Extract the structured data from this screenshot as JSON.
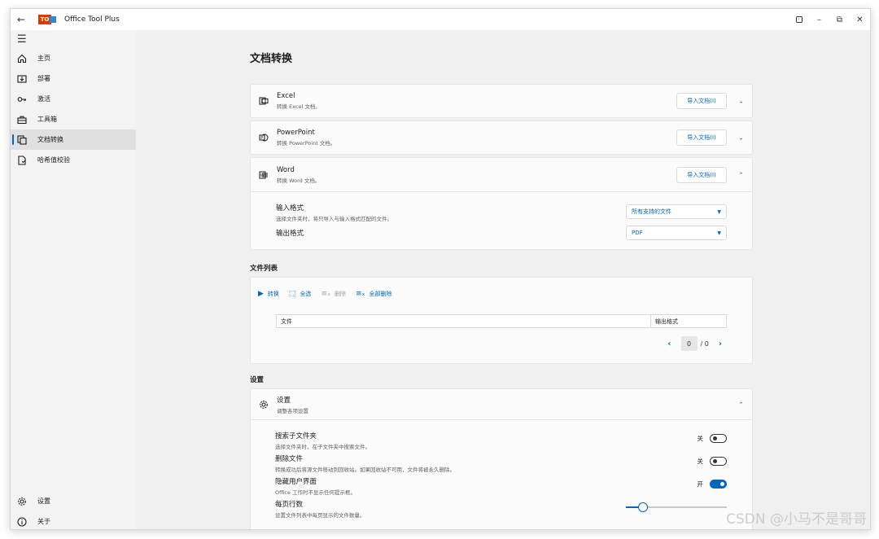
{
  "titlebar": {
    "app_title": "Office Tool Plus"
  },
  "sidebar": {
    "items": [
      {
        "label": "主页",
        "icon": "home-icon"
      },
      {
        "label": "部署",
        "icon": "deploy-icon"
      },
      {
        "label": "激活",
        "icon": "key-icon"
      },
      {
        "label": "工具箱",
        "icon": "toolbox-icon"
      },
      {
        "label": "文档转换",
        "icon": "convert-icon",
        "active": true
      },
      {
        "label": "哈希值校验",
        "icon": "hash-file-icon"
      }
    ],
    "bottom": [
      {
        "label": "设置",
        "icon": "gear-icon"
      },
      {
        "label": "关于",
        "icon": "info-icon"
      }
    ]
  },
  "page": {
    "title": "文档转换"
  },
  "converters": [
    {
      "title": "Excel",
      "sub": "转换 Excel 文档。",
      "button": "导入文档(I)",
      "chevron": "⌄"
    },
    {
      "title": "PowerPoint",
      "sub": "转换 PowerPoint 文档。",
      "button": "导入文档(I)",
      "chevron": "⌄"
    },
    {
      "title": "Word",
      "sub": "转换 Word 文档。",
      "button": "导入文档(I)",
      "chevron": "⌃"
    }
  ],
  "word_options": {
    "input_title": "输入格式",
    "input_sub": "选择文件夹时，将只导入与输入格式匹配的文件。",
    "input_value": "所有支持的文件",
    "output_title": "输出格式",
    "output_value": "PDF"
  },
  "file_list": {
    "label": "文件列表",
    "tools": {
      "convert": "转换",
      "select_all": "全选",
      "delete": "删除",
      "delete_all": "全部删除"
    },
    "columns": {
      "file": "文件",
      "output": "输出格式"
    },
    "pager": {
      "current": "0",
      "total": "/ 0"
    }
  },
  "settings": {
    "label": "设置",
    "card_title": "设置",
    "card_sub": "调整各项设置",
    "rows": [
      {
        "title": "搜索子文件夹",
        "sub": "选择文件夹时，在子文件夹中搜索文件。",
        "state": "关",
        "on": false
      },
      {
        "title": "删除文件",
        "sub": "转换成功后将源文件移动到回收站。如果回收站不可用，文件将被永久删除。",
        "state": "关",
        "on": false
      },
      {
        "title": "隐藏用户界面",
        "sub": "Office 工作时不显示任何提示框。",
        "state": "开",
        "on": true
      },
      {
        "title": "每页行数",
        "sub": "设置文件列表中每页显示的文件数量。"
      }
    ],
    "rows_per_page_level": 0.13
  },
  "watermark": "CSDN @小马不是哥哥",
  "colors": {
    "accent": "#0067c0"
  }
}
